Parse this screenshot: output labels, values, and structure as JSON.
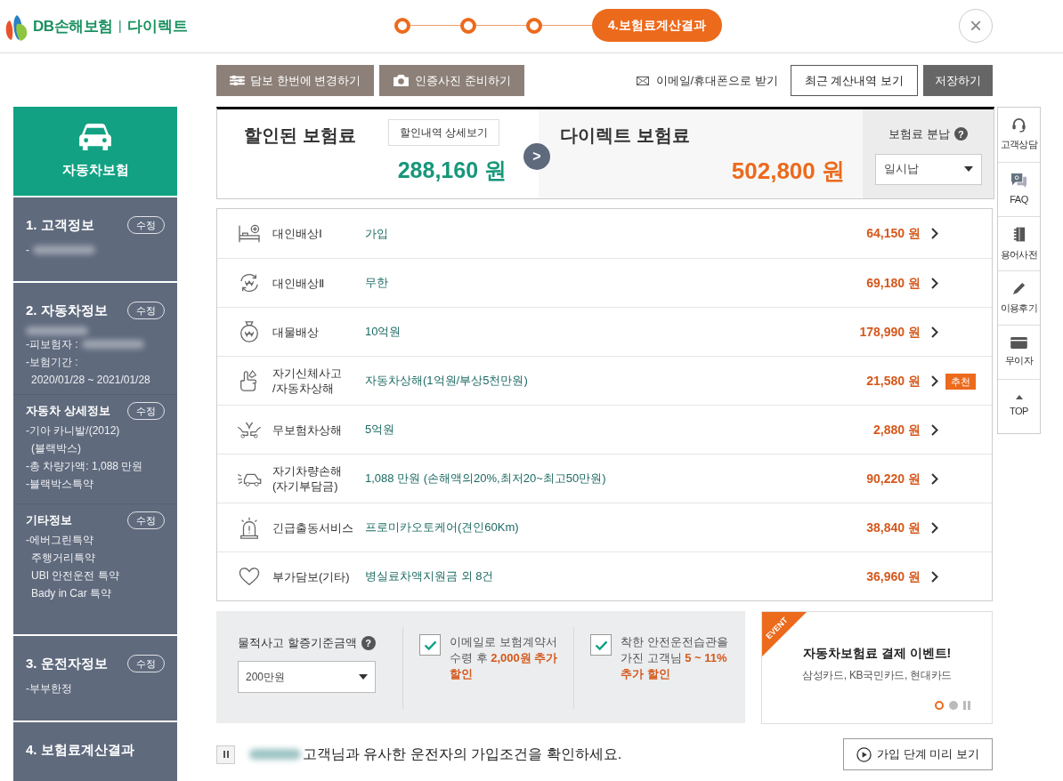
{
  "logo": {
    "brand": "DB손해보험",
    "divider": "|",
    "product": "다이렉트"
  },
  "steps": [
    {
      "selected": false
    },
    {
      "selected": false
    },
    {
      "selected": false
    },
    {
      "selected": true,
      "label": "4.보험료계산결과"
    }
  ],
  "close": "×",
  "sidebar": {
    "product": "자동차보험",
    "sections": [
      {
        "title": "1. 고객정보",
        "edit": "수정",
        "lines": [
          {
            "text": "-",
            "redacted": true
          }
        ]
      },
      {
        "title": "2. 자동차정보",
        "edit": "수정",
        "lines": [
          {
            "redacted": true
          },
          {
            "text": "-피보험자 :",
            "redacted": true
          },
          {
            "text": "-보험기간 :"
          },
          {
            "text": "2020/01/28 ~ 2021/01/28",
            "continued": true
          }
        ],
        "subsections": [
          {
            "title": "자동차 상세정보",
            "edit": "수정",
            "lines": [
              {
                "text": "-기아 카니발/(2012)"
              },
              {
                "text": "(블랙박스)",
                "continued": true
              },
              {
                "text": "-총 차량가액: 1,088 만원"
              },
              {
                "text": "-블랙박스특약"
              }
            ]
          },
          {
            "title": "기타정보",
            "edit": "수정",
            "lines": [
              {
                "text": "-에버그린특약"
              },
              {
                "text": "주행거리특약",
                "continued": true
              },
              {
                "text": "UBI 안전운전 특약",
                "continued": true
              },
              {
                "text": "Bady in Car 특약",
                "continued": true
              }
            ]
          }
        ]
      },
      {
        "title": "3. 운전자정보",
        "edit": "수정",
        "lines": [
          {
            "text": "-부부한정"
          }
        ]
      },
      {
        "title": "4. 보험료계산결과"
      }
    ]
  },
  "toolbar": {
    "change_button": "담보 한번에 변경하기",
    "photo_button": "인증사진 준비하기",
    "email_link": "이메일/휴대폰으로 받기",
    "history_button": "최근 계산내역 보기",
    "save_button": "저장하기"
  },
  "premium": {
    "discount_title": "할인된 보험료",
    "detail_button": "할인내역 상세보기",
    "discount_amount": "288,160 원",
    "arrow": ">",
    "direct_title": "다이렉트 보험료",
    "direct_amount": "502,800 원",
    "installment_label": "보험료 분납",
    "help": "?",
    "installment_value": "일시납"
  },
  "coverages": [
    {
      "name": "대인배상Ⅰ",
      "value": "가입",
      "price": "64,150 원"
    },
    {
      "name": "대인배상Ⅱ",
      "value": "무한",
      "price": "69,180 원"
    },
    {
      "name": "대물배상",
      "value": "10억원",
      "price": "178,990 원"
    },
    {
      "name": "자기신체사고\n/자동차상해",
      "value": "자동차상해(1억원/부상5천만원)",
      "price": "21,580 원",
      "badge": "추천"
    },
    {
      "name": "무보험차상해",
      "value": "5억원",
      "price": "2,880 원"
    },
    {
      "name": "자기차량손해\n(자기부담금)",
      "value": "1,088 만원 (손해액의20%,최저20~최고50만원)",
      "price": "90,220 원"
    },
    {
      "name": "긴급출동서비스",
      "value": "프로미카오토케어(견인60Km)",
      "price": "38,840 원"
    },
    {
      "name": "부가담보(기타)",
      "value": "병실료차액지원금 외 8건",
      "price": "36,960 원"
    }
  ],
  "options": {
    "threshold_label": "물적사고 할증기준금액",
    "help": "?",
    "threshold_value": "200만원",
    "discounts": [
      {
        "text": "이메일로 보험계약서 수령 후 **2,000원 추가 할인**",
        "checked": true
      },
      {
        "text": "착한 안전운전습관을 가진 고객님 **5 ~ 11% 추가 할인**",
        "checked": true
      }
    ]
  },
  "event": {
    "tag": "EVENT",
    "title": "자동차보험료 결제 이벤트!",
    "subtitle": "삼성카드, KB국민카드, 현대카드",
    "dots": [
      {
        "selected": true
      },
      {
        "selected": false
      }
    ]
  },
  "footer": {
    "message": "고객님과 유사한 운전자의 가입조건을 확인하세요.",
    "preview_button": "가입 단계 미리 보기"
  },
  "quick_menu": [
    {
      "label": "고객상담"
    },
    {
      "label": "FAQ"
    },
    {
      "label": "용어사전"
    },
    {
      "label": "이용후기"
    },
    {
      "label": "무이자"
    },
    {
      "label": "TOP"
    }
  ]
}
